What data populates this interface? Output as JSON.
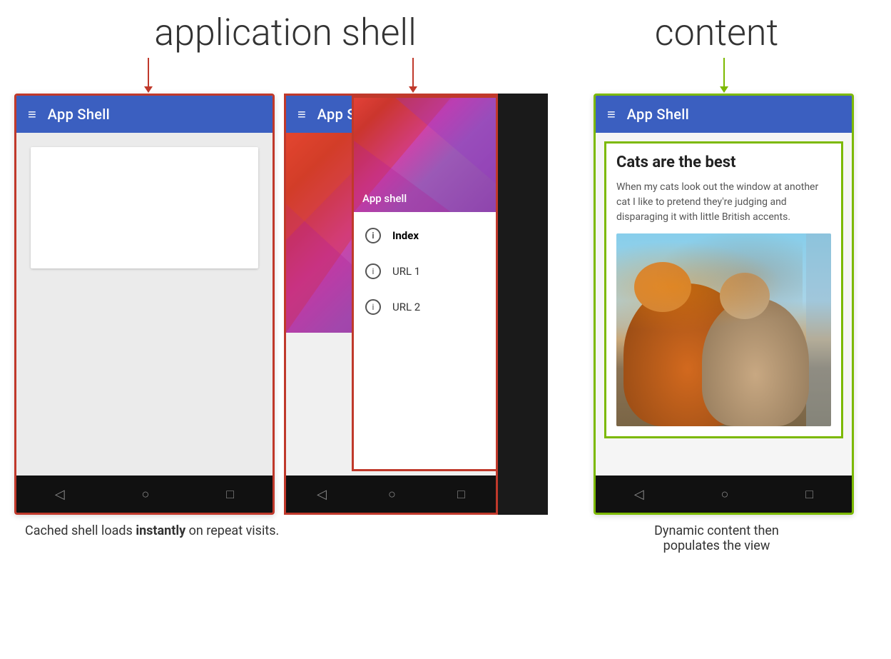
{
  "labels": {
    "app_shell_header": "application shell",
    "content_header": "content",
    "caption_left": "Cached shell loads instantly on repeat visits.",
    "caption_left_bold": "instantly",
    "caption_right_line1": "Dynamic content then",
    "caption_right_line2": "populates the view"
  },
  "phone1": {
    "app_bar_title": "App Shell",
    "hamburger": "≡"
  },
  "phone2": {
    "app_bar_title": "App Shell",
    "hamburger": "≡",
    "drawer_header_label": "App shell",
    "drawer_items": [
      {
        "label": "Index",
        "bold": true
      },
      {
        "label": "URL 1",
        "bold": false
      },
      {
        "label": "URL 2",
        "bold": false
      }
    ]
  },
  "phone3": {
    "app_bar_title": "App Shell",
    "hamburger": "≡",
    "content_title": "Cats are the best",
    "content_text": "When my cats look out the window at another cat I like to pretend they're judging and disparaging it with little British accents."
  },
  "colors": {
    "app_bar_blue": "#3b5fc0",
    "border_pink": "#c0392b",
    "border_green": "#7cb900",
    "arrow_red": "#c0392b",
    "arrow_green": "#7cb900",
    "nav_bar_bg": "#111111"
  },
  "nav_icons": {
    "back": "◁",
    "home": "○",
    "recents": "□"
  }
}
